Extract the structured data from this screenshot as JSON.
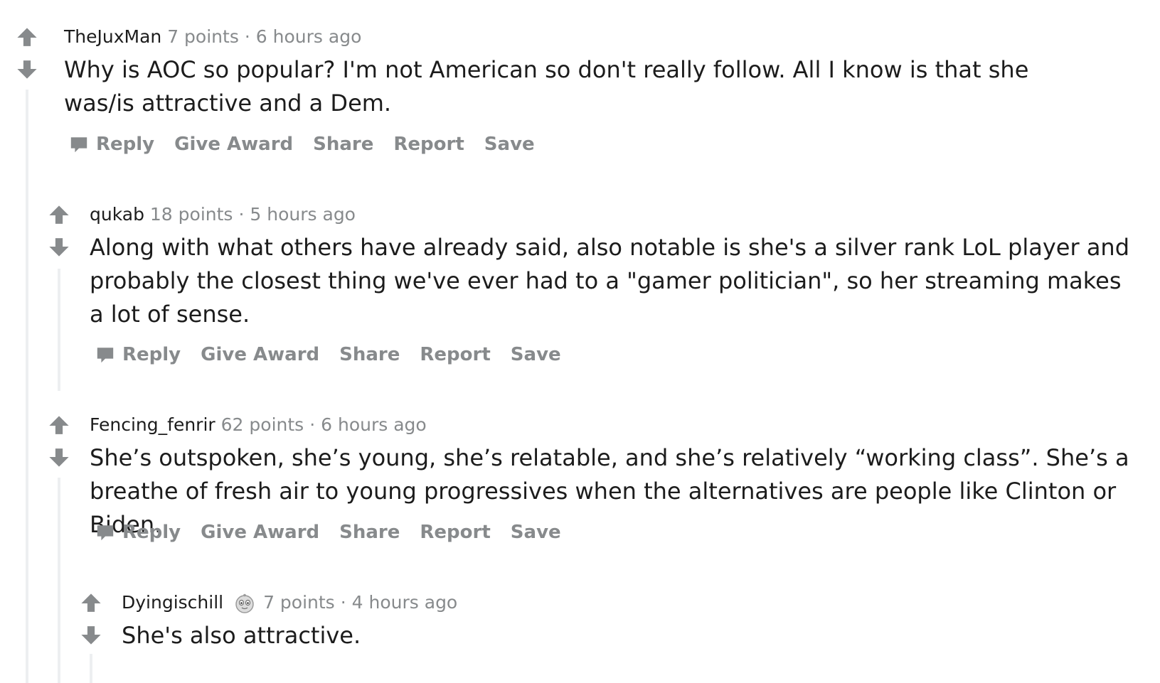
{
  "colors": {
    "arrow": "#878a8c",
    "meta": "#878a8c",
    "text": "#1c1c1c",
    "thread_line": "#edeff1"
  },
  "comments": [
    {
      "author": "TheJuxMan",
      "points": "7 points",
      "separator": "·",
      "time": "6 hours ago",
      "body": "Why is AOC so popular? I'm not American so don't really follow. All I know is that she was/is attractive and a Dem.",
      "actions": {
        "reply": "Reply",
        "award": "Give Award",
        "share": "Share",
        "report": "Report",
        "save": "Save"
      }
    },
    {
      "author": "qukab",
      "points": "18 points",
      "separator": "·",
      "time": "5 hours ago",
      "body": "Along with what others have already said, also notable is she's a silver rank LoL player and probably the closest thing we've ever had to a \"gamer politician\", so her streaming makes a lot of sense.",
      "actions": {
        "reply": "Reply",
        "award": "Give Award",
        "share": "Share",
        "report": "Report",
        "save": "Save"
      }
    },
    {
      "author": "Fencing_fenrir",
      "points": "62 points",
      "separator": "·",
      "time": "6 hours ago",
      "body": "She’s outspoken, she’s young, she’s relatable, and she’s relatively “working class”. She’s a breathe of fresh air to young progressives when the alternatives are people like Clinton or Biden.",
      "actions": {
        "reply": "Reply",
        "award": "Give Award",
        "share": "Share",
        "report": "Report",
        "save": "Save"
      }
    },
    {
      "author": "Dyingischill",
      "flair_icon": "snoo-avatar-icon",
      "points": "7 points",
      "separator": "·",
      "time": "4 hours ago",
      "body": "She's also attractive."
    }
  ]
}
